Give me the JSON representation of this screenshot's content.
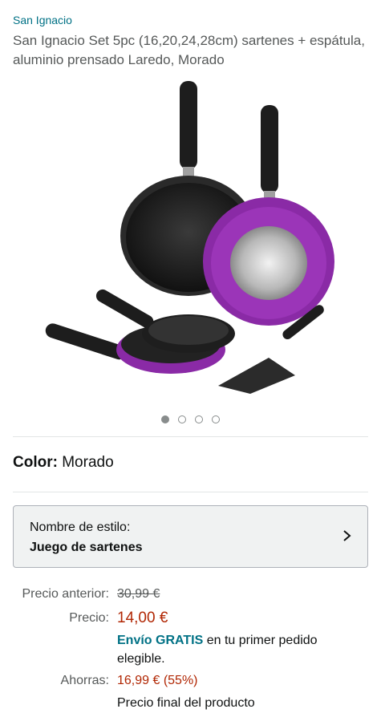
{
  "brand": "San Ignacio",
  "title": "San Ignacio Set 5pc (16,20,24,28cm) sartenes + espátula, aluminio prensado Laredo, Morado",
  "image_icon": "frying-pan-set-image",
  "carousel": {
    "total": 4,
    "active": 1
  },
  "color": {
    "label": "Color:",
    "value": "Morado"
  },
  "style": {
    "label": "Nombre de estilo:",
    "value": "Juego de sartenes"
  },
  "pricing": {
    "prev_label": "Precio anterior:",
    "prev_value": "30,99 €",
    "price_label": "Precio:",
    "price_value": "14,00 €",
    "shipping_bold": "Envío GRATIS",
    "shipping_rest": " en tu primer pedido elegible.",
    "save_label": "Ahorras:",
    "save_value": "16,99 € (55%)",
    "final_note": "Precio final del producto"
  },
  "colors": {
    "link": "#007185",
    "price": "#b12704",
    "purple": "#8a2aa6"
  }
}
